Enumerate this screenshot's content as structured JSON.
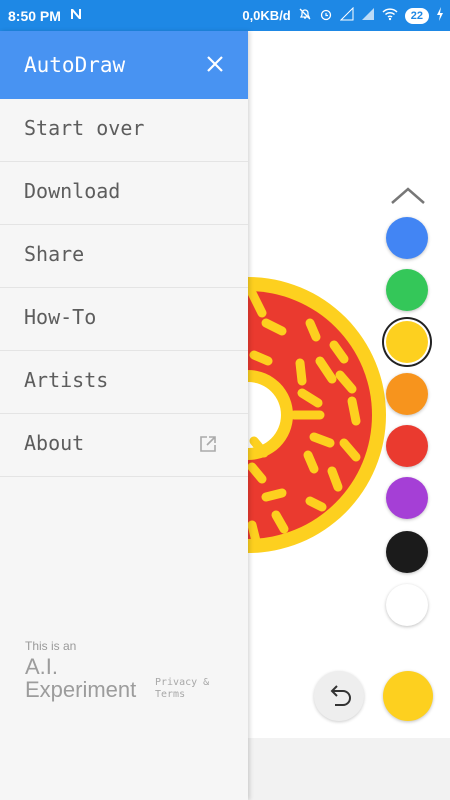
{
  "status_bar": {
    "time": "8:50 PM",
    "network_speed": "0,0KB/d",
    "battery": "22",
    "icons": [
      "notification-n-icon",
      "mute-icon",
      "alarm-icon",
      "signal-icon",
      "4g-signal-icon",
      "wifi-icon",
      "battery-icon",
      "charging-icon"
    ]
  },
  "drawer": {
    "title": "AutoDraw",
    "menu": [
      {
        "label": "Start over"
      },
      {
        "label": "Download"
      },
      {
        "label": "Share"
      },
      {
        "label": "How-To"
      },
      {
        "label": "Artists"
      },
      {
        "label": "About",
        "icon": "external-link-icon"
      }
    ],
    "footer": {
      "tagline": "This is an",
      "brand_line1": "A.I.",
      "brand_line2": "Experiment",
      "link_privacy": "Privacy &",
      "link_terms": "Terms"
    }
  },
  "palette": {
    "colors": [
      "#4285f4",
      "#34c759",
      "#fdd01f",
      "#f7941d",
      "#ea3a2f",
      "#a53fd6",
      "#1b1b1b",
      "#ffffff"
    ],
    "selected_index": 2,
    "current_color": "#fdd01f"
  },
  "canvas": {
    "drawing": "donut",
    "donut_colors": {
      "rim": "#fdd01f",
      "frosting": "#ea3a2f",
      "sprinkles": "#fdd01f"
    }
  },
  "theme": {
    "header_blue": "#4893f2",
    "status_blue": "#1e88e5"
  }
}
